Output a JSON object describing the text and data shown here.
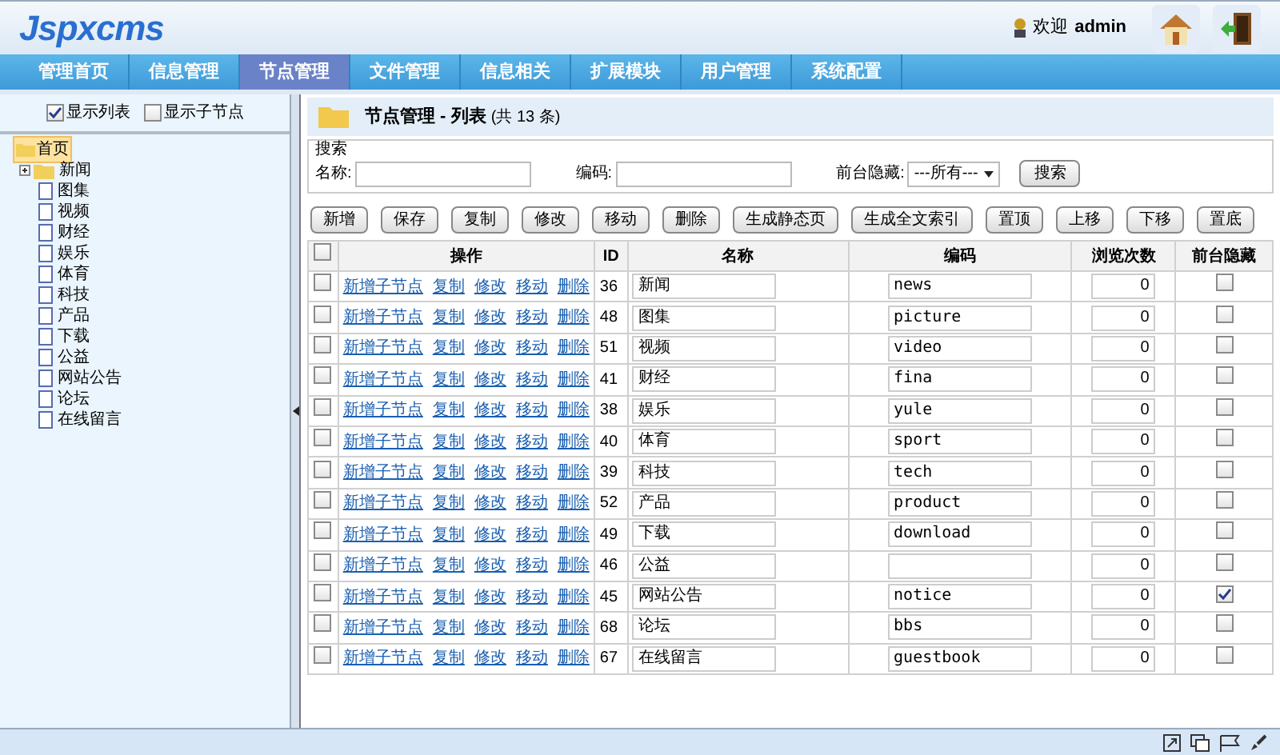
{
  "header": {
    "logo": "Jspxcms",
    "welcome": "欢迎",
    "user": "admin"
  },
  "nav": [
    {
      "label": "管理首页",
      "selected": false
    },
    {
      "label": "信息管理",
      "selected": false
    },
    {
      "label": "节点管理",
      "selected": true
    },
    {
      "label": "文件管理",
      "selected": false
    },
    {
      "label": "信息相关",
      "selected": false
    },
    {
      "label": "扩展模块",
      "selected": false
    },
    {
      "label": "用户管理",
      "selected": false
    },
    {
      "label": "系统配置",
      "selected": false
    }
  ],
  "sidebar": {
    "options": [
      {
        "label": "显示列表",
        "checked": true
      },
      {
        "label": "显示子节点",
        "checked": false
      }
    ],
    "tree": [
      {
        "label": "首页",
        "kind": "root",
        "selected": true,
        "children": [
          {
            "label": "新闻",
            "kind": "folder",
            "selected": false
          },
          {
            "label": "图集",
            "kind": "page",
            "selected": false
          },
          {
            "label": "视频",
            "kind": "page",
            "selected": false
          },
          {
            "label": "财经",
            "kind": "page",
            "selected": false
          },
          {
            "label": "娱乐",
            "kind": "page",
            "selected": false
          },
          {
            "label": "体育",
            "kind": "page",
            "selected": false
          },
          {
            "label": "科技",
            "kind": "page",
            "selected": false
          },
          {
            "label": "产品",
            "kind": "page",
            "selected": false
          },
          {
            "label": "下载",
            "kind": "page",
            "selected": false
          },
          {
            "label": "公益",
            "kind": "page",
            "selected": false
          },
          {
            "label": "网站公告",
            "kind": "page",
            "selected": false
          },
          {
            "label": "论坛",
            "kind": "page",
            "selected": false
          },
          {
            "label": "在线留言",
            "kind": "page",
            "selected": false
          }
        ]
      }
    ]
  },
  "main": {
    "title": "节点管理 - 列表",
    "count": "(共 13 条)",
    "search": {
      "legend": "搜索",
      "name_label": "名称:",
      "code_label": "编码:",
      "hidden_label": "前台隐藏:",
      "hidden_value": "---所有---",
      "button": "搜索"
    },
    "toolbar": [
      "新增",
      "保存",
      "复制",
      "修改",
      "移动",
      "删除",
      "生成静态页",
      "生成全文索引",
      "置顶",
      "上移",
      "下移",
      "置底"
    ]
  },
  "table": {
    "select_all": false,
    "columns": [
      "操作",
      "ID",
      "名称",
      "编码",
      "浏览次数",
      "前台隐藏"
    ],
    "rows": [
      {
        "checked": false,
        "actions": [
          "新增子节点",
          "复制",
          "修改",
          "移动",
          "删除"
        ],
        "id": "36",
        "name": "新闻",
        "code": "news",
        "views": "0",
        "hidden": false
      },
      {
        "checked": false,
        "actions": [
          "新增子节点",
          "复制",
          "修改",
          "移动",
          "删除"
        ],
        "id": "48",
        "name": "图集",
        "code": "picture",
        "views": "0",
        "hidden": false
      },
      {
        "checked": false,
        "actions": [
          "新增子节点",
          "复制",
          "修改",
          "移动",
          "删除"
        ],
        "id": "51",
        "name": "视频",
        "code": "video",
        "views": "0",
        "hidden": false
      },
      {
        "checked": false,
        "actions": [
          "新增子节点",
          "复制",
          "修改",
          "移动",
          "删除"
        ],
        "id": "41",
        "name": "财经",
        "code": "fina",
        "views": "0",
        "hidden": false
      },
      {
        "checked": false,
        "actions": [
          "新增子节点",
          "复制",
          "修改",
          "移动",
          "删除"
        ],
        "id": "38",
        "name": "娱乐",
        "code": "yule",
        "views": "0",
        "hidden": false
      },
      {
        "checked": false,
        "actions": [
          "新增子节点",
          "复制",
          "修改",
          "移动",
          "删除"
        ],
        "id": "40",
        "name": "体育",
        "code": "sport",
        "views": "0",
        "hidden": false
      },
      {
        "checked": false,
        "actions": [
          "新增子节点",
          "复制",
          "修改",
          "移动",
          "删除"
        ],
        "id": "39",
        "name": "科技",
        "code": "tech",
        "views": "0",
        "hidden": false
      },
      {
        "checked": false,
        "actions": [
          "新增子节点",
          "复制",
          "修改",
          "移动",
          "删除"
        ],
        "id": "52",
        "name": "产品",
        "code": "product",
        "views": "0",
        "hidden": false
      },
      {
        "checked": false,
        "actions": [
          "新增子节点",
          "复制",
          "修改",
          "移动",
          "删除"
        ],
        "id": "49",
        "name": "下载",
        "code": "download",
        "views": "0",
        "hidden": false
      },
      {
        "checked": false,
        "actions": [
          "新增子节点",
          "复制",
          "修改",
          "移动",
          "删除"
        ],
        "id": "46",
        "name": "公益",
        "views": "0",
        "hidden": false
      },
      {
        "checked": false,
        "actions": [
          "新增子节点",
          "复制",
          "修改",
          "移动",
          "删除"
        ],
        "id": "45",
        "name": "网站公告",
        "code": "notice",
        "views": "0",
        "hidden": true
      },
      {
        "checked": false,
        "actions": [
          "新增子节点",
          "复制",
          "修改",
          "移动",
          "删除"
        ],
        "id": "68",
        "name": "论坛",
        "code": "bbs",
        "views": "0",
        "hidden": false
      },
      {
        "checked": false,
        "actions": [
          "新增子节点",
          "复制",
          "修改",
          "移动",
          "删除"
        ],
        "id": "67",
        "name": "在线留言",
        "code": "guestbook",
        "views": "0",
        "hidden": false
      }
    ]
  }
}
